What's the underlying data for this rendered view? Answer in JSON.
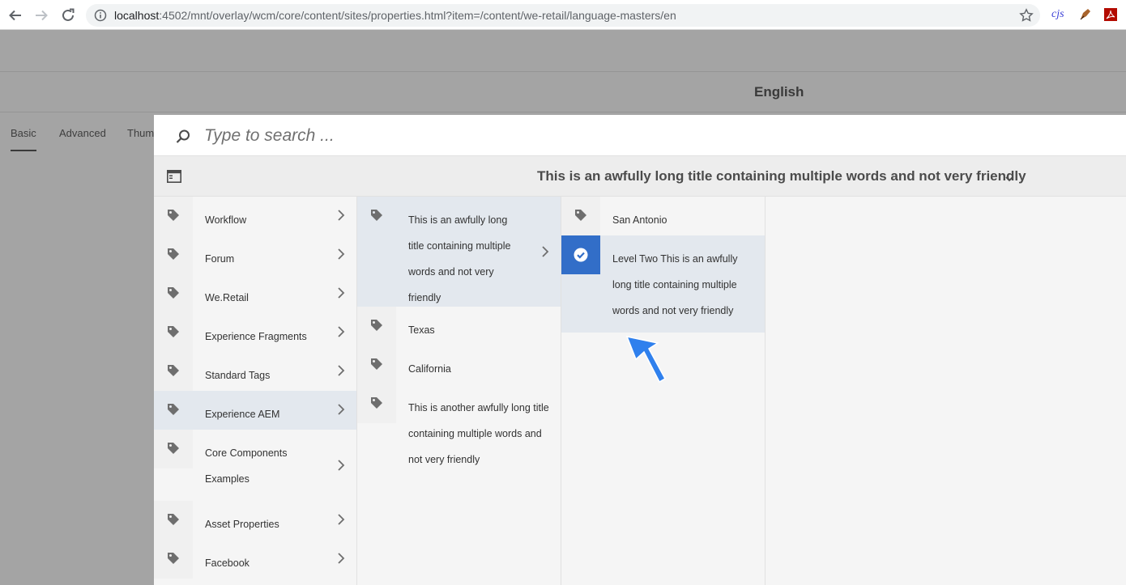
{
  "browser": {
    "url_host": "localhost",
    "url_path": ":4502/mnt/overlay/wcm/core/content/sites/properties.html?item=/content/we-retail/language-masters/en",
    "ext_cjs": "cjs"
  },
  "page": {
    "title": "English",
    "tabs": [
      "Basic",
      "Advanced",
      "Thumb"
    ]
  },
  "picker": {
    "search_placeholder": "Type to search ...",
    "current_title": "This is an awfully long title containing multiple words and not very friendly",
    "columns": [
      {
        "items": [
          {
            "label": "Workflow"
          },
          {
            "label": "Forum"
          },
          {
            "label": "We.Retail"
          },
          {
            "label": "Experience Fragments"
          },
          {
            "label": "Standard Tags"
          },
          {
            "label": "Experience AEM"
          },
          {
            "label": "Core Components Examples"
          },
          {
            "label": "Asset Properties"
          },
          {
            "label": "Facebook"
          }
        ]
      },
      {
        "items": [
          {
            "label": "This is an awfully long title containing multiple words and not very friendly"
          },
          {
            "label": "Texas"
          },
          {
            "label": "California"
          },
          {
            "label": "This is another awfully long title containing multiple words and not very friendly"
          }
        ]
      },
      {
        "items": [
          {
            "label": "San Antonio"
          },
          {
            "label": "Level Two This is an awfully long title containing multiple words and not very friendly"
          }
        ]
      }
    ]
  },
  "colors": {
    "accent": "#326ec8",
    "pointer": "#2f80ed",
    "overlay": "#a4a4a4"
  }
}
